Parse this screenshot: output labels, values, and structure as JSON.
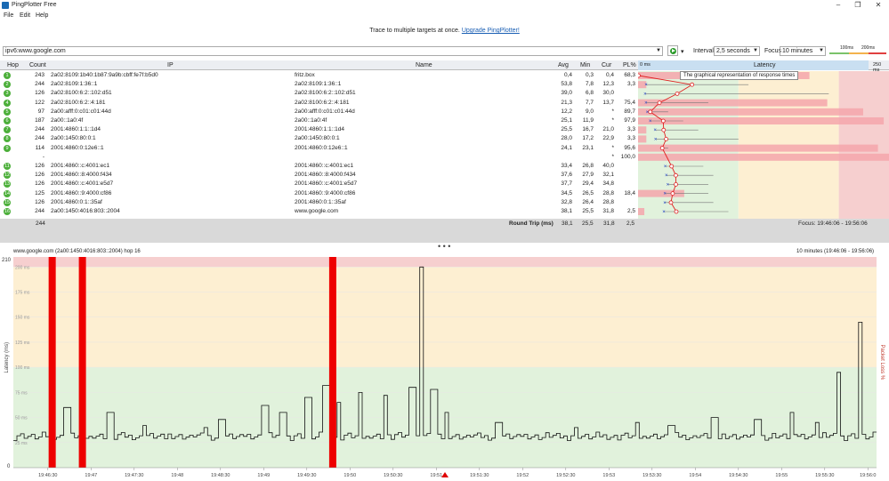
{
  "app": {
    "title": "PingPlotter Free",
    "menu": [
      "File",
      "Edit",
      "Help"
    ]
  },
  "banner": {
    "text": "Trace to multiple targets at once.",
    "link": "Upgrade PingPlotter!"
  },
  "toolbar": {
    "target": "ipv6:www.google.com",
    "interval_label": "Interval",
    "interval_value": "2,5 seconds",
    "focus_label": "Focus",
    "focus_value": "10 minutes",
    "scale_100": "100ms",
    "scale_200": "200ms"
  },
  "columns": {
    "hop": "Hop",
    "count": "Count",
    "ip": "IP",
    "name": "Name",
    "avg": "Avg",
    "min": "Min",
    "cur": "Cur",
    "pl": "PL%",
    "latency": "Latency",
    "lat_min": "0 ms",
    "lat_max": "250 ms"
  },
  "tooltip": "The graphical representation of response times",
  "hops": [
    {
      "hop": "1",
      "count": "243",
      "ip": "2a02:8109:1b40:1b87:9a9b:cbff:fe7f:b5d0",
      "name": "fritz.box",
      "avg": "0,4",
      "min": "0,3",
      "cur": "0,4",
      "pl": "68,3",
      "a": 0.4,
      "mn": 0.3,
      "mx": 2,
      "plv": 68.3
    },
    {
      "hop": "2",
      "count": "244",
      "ip": "2a02:8109:1:36::1",
      "name": "2a02:8109:1:36::1",
      "avg": "53,8",
      "min": "7,8",
      "cur": "12,3",
      "pl": "3,3",
      "a": 53.8,
      "mn": 7.8,
      "mx": 110,
      "plv": 3.3
    },
    {
      "hop": "3",
      "count": "126",
      "ip": "2a02:8100:6:2::102:d51",
      "name": "2a02:8100:6:2::102:d51",
      "avg": "39,0",
      "min": "6,8",
      "cur": "30,0",
      "pl": "",
      "a": 39,
      "mn": 6.8,
      "mx": 190,
      "plv": 0
    },
    {
      "hop": "4",
      "count": "122",
      "ip": "2a02:8100:6:2::4:181",
      "name": "2a02:8100:6:2::4:181",
      "avg": "21,3",
      "min": "7,7",
      "cur": "13,7",
      "pl": "75,4",
      "a": 21.3,
      "mn": 7.7,
      "mx": 70,
      "plv": 75.4
    },
    {
      "hop": "5",
      "count": "97",
      "ip": "2a00:afff:0:c01:c01:44d",
      "name": "2a00:afff:0:c01:c01:44d",
      "avg": "12,2",
      "min": "9,0",
      "cur": "*",
      "pl": "89,7",
      "a": 12.2,
      "mn": 9,
      "mx": 30,
      "plv": 89.7
    },
    {
      "hop": "6",
      "count": "187",
      "ip": "2a00::1a0:4f",
      "name": "2a00::1a0:4f",
      "avg": "25,1",
      "min": "11,9",
      "cur": "*",
      "pl": "97,9",
      "a": 25.1,
      "mn": 11.9,
      "mx": 45,
      "plv": 97.9
    },
    {
      "hop": "7",
      "count": "244",
      "ip": "2001:4860:1:1::1d4",
      "name": "2001:4860:1:1::1d4",
      "avg": "25,5",
      "min": "16,7",
      "cur": "21,0",
      "pl": "3,3",
      "a": 25.5,
      "mn": 16.7,
      "mx": 60,
      "plv": 3.3
    },
    {
      "hop": "8",
      "count": "244",
      "ip": "2a00:1450:80:0:1",
      "name": "2a00:1450:80:0:1",
      "avg": "28,0",
      "min": "17,2",
      "cur": "22,9",
      "pl": "3,3",
      "a": 28,
      "mn": 17.2,
      "mx": 100,
      "plv": 3.3
    },
    {
      "hop": "9",
      "count": "114",
      "ip": "2001:4860:0:12e6::1",
      "name": "2001:4860:0:12e6::1",
      "avg": "24,1",
      "min": "23,1",
      "cur": "*",
      "pl": "95,6",
      "a": 24.1,
      "mn": 23.1,
      "mx": 30,
      "plv": 95.6
    },
    {
      "hop": "",
      "count": "-",
      "ip": "",
      "name": "",
      "avg": "",
      "min": "",
      "cur": "*",
      "pl": "100,0",
      "a": null,
      "mn": null,
      "mx": null,
      "plv": 100
    },
    {
      "hop": "11",
      "count": "126",
      "ip": "2001:4860::c:4001:ec1",
      "name": "2001:4860::c:4001:ec1",
      "avg": "33,4",
      "min": "26,8",
      "cur": "40,0",
      "pl": "",
      "a": 33.4,
      "mn": 26.8,
      "mx": 65,
      "plv": 0
    },
    {
      "hop": "12",
      "count": "126",
      "ip": "2001:4860::8:4000:f434",
      "name": "2001:4860::8:4000:f434",
      "avg": "37,6",
      "min": "27,9",
      "cur": "32,1",
      "pl": "",
      "a": 37.6,
      "mn": 27.9,
      "mx": 75,
      "plv": 0
    },
    {
      "hop": "13",
      "count": "126",
      "ip": "2001:4860::c:4001:e5d7",
      "name": "2001:4860::c:4001:e5d7",
      "avg": "37,7",
      "min": "29,4",
      "cur": "34,8",
      "pl": "",
      "a": 37.7,
      "mn": 29.4,
      "mx": 70,
      "plv": 0
    },
    {
      "hop": "14",
      "count": "125",
      "ip": "2001:4860::9:4000:cf86",
      "name": "2001:4860::9:4000:cf86",
      "avg": "34,5",
      "min": "26,5",
      "cur": "28,8",
      "pl": "18,4",
      "a": 34.5,
      "mn": 26.5,
      "mx": 70,
      "plv": 18.4
    },
    {
      "hop": "15",
      "count": "126",
      "ip": "2001:4860:0:1::35af",
      "name": "2001:4860:0:1::35af",
      "avg": "32,8",
      "min": "26,4",
      "cur": "28,8",
      "pl": "",
      "a": 32.8,
      "mn": 26.4,
      "mx": 75,
      "plv": 0
    },
    {
      "hop": "16",
      "count": "244",
      "ip": "2a00:1450:4016:803::2004",
      "name": "www.google.com",
      "avg": "38,1",
      "min": "25,5",
      "cur": "31,8",
      "pl": "2,5",
      "a": 38.1,
      "mn": 25.5,
      "mx": 90,
      "plv": 2.5
    }
  ],
  "footer": {
    "count": "244",
    "label": "Round Trip (ms)",
    "avg": "38,1",
    "min": "25,5",
    "cur": "31,8",
    "pl": "2,5",
    "focus": "Focus: 19:46:06 - 19:56:06"
  },
  "graph": {
    "title": "www.google.com (2a00:1450:4016:803::2004) hop 16",
    "range": "10 minutes (19:46:06 - 19:56:06)",
    "ylabel": "Latency (ms)",
    "y2label": "Packet Loss %",
    "ymax": "210",
    "ymin": "0",
    "yticks": [
      "200 ms",
      "175 ms",
      "150 ms",
      "125 ms",
      "100 ms",
      "75 ms",
      "50 ms",
      "25 ms"
    ],
    "xticks": [
      "19:46:30",
      "19:47",
      "19:47:30",
      "19:48",
      "19:48:30",
      "19:49",
      "19:49:30",
      "19:50",
      "19:50:30",
      "19:51",
      "19:51:30",
      "19:52",
      "19:52:30",
      "19:53",
      "19:53:30",
      "19:54",
      "19:54:30",
      "19:55",
      "19:55:30",
      "19:56:0"
    ],
    "loss_markers_min": [
      0.45,
      0.8,
      3.7
    ],
    "spikes": [
      [
        0.6,
        60
      ],
      [
        1.1,
        55
      ],
      [
        1.5,
        42
      ],
      [
        2.2,
        40
      ],
      [
        2.4,
        48
      ],
      [
        2.9,
        62
      ],
      [
        3.1,
        55
      ],
      [
        3.4,
        70
      ],
      [
        3.6,
        82
      ],
      [
        3.75,
        65
      ],
      [
        4.0,
        75
      ],
      [
        4.3,
        72
      ],
      [
        4.6,
        80
      ],
      [
        4.7,
        200
      ],
      [
        4.85,
        78
      ],
      [
        5.0,
        55
      ],
      [
        5.6,
        45
      ],
      [
        6.5,
        40
      ],
      [
        7.2,
        45
      ],
      [
        7.6,
        42
      ],
      [
        8.1,
        50
      ],
      [
        8.6,
        48
      ],
      [
        9.0,
        55
      ],
      [
        9.3,
        45
      ],
      [
        9.55,
        95
      ],
      [
        9.8,
        145
      ]
    ]
  },
  "colors": {
    "green": "#e1f2dc",
    "yellow": "#fdefd2",
    "red": "#f6cfcf",
    "lossbar": "#ee0000",
    "hop": "#4caf3a"
  }
}
